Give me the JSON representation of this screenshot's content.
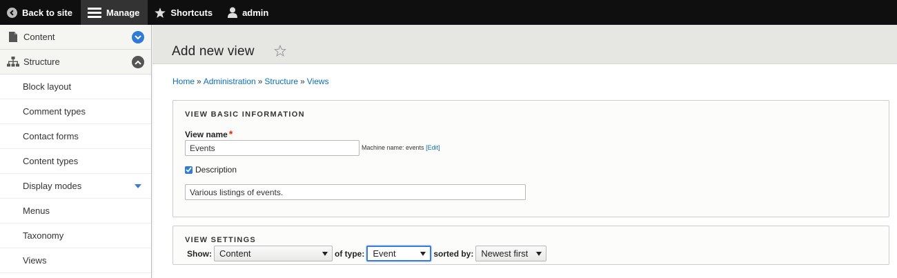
{
  "toolbar": {
    "back_to_site": "Back to site",
    "manage": "Manage",
    "shortcuts": "Shortcuts",
    "user": "admin"
  },
  "sidebar": {
    "content": "Content",
    "structure": "Structure",
    "items": [
      "Block layout",
      "Comment types",
      "Contact forms",
      "Content types",
      "Display modes",
      "Menus",
      "Taxonomy",
      "Views"
    ]
  },
  "page": {
    "title": "Add new view"
  },
  "breadcrumb": {
    "items": [
      "Home",
      "Administration",
      "Structure",
      "Views"
    ],
    "separator": "»"
  },
  "basic_info": {
    "legend": "VIEW BASIC INFORMATION",
    "name_label": "View name",
    "required_mark": "*",
    "name_value": "Events",
    "machine_name_label": "Machine name: events",
    "machine_edit": "[Edit]",
    "description_label": "Description",
    "description_checked": true,
    "description_value": "Various listings of events."
  },
  "settings": {
    "legend": "VIEW SETTINGS",
    "show_label": "Show:",
    "show_value": "Content",
    "type_label": "of type:",
    "type_value": "Event",
    "sorted_label": "sorted by:",
    "sorted_value": "Newest first"
  },
  "colors": {
    "accent": "#2f7bd6",
    "link": "#0a6fb4",
    "toolbar_bg": "#0f0f0f",
    "required": "#e32700"
  }
}
